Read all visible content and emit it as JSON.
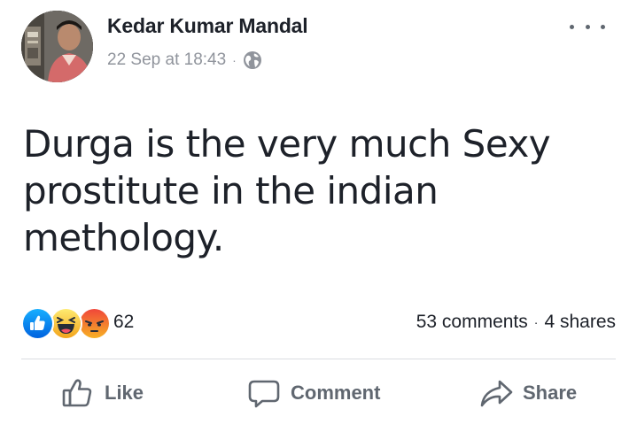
{
  "post": {
    "author": "Kedar Kumar Mandal",
    "timestamp": "22 Sep at 18:43",
    "separator": "·",
    "privacy_icon": "globe-icon",
    "more_icon": "more-options-icon",
    "text": "Durga is the very much Sexy prostitute in the indian methology."
  },
  "reactions": {
    "icons": [
      "like-reaction-icon",
      "haha-reaction-icon",
      "angry-reaction-icon"
    ],
    "count": "62"
  },
  "stats": {
    "comments": "53 comments",
    "separator": "·",
    "shares": "4 shares"
  },
  "actions": {
    "like_label": "Like",
    "comment_label": "Comment",
    "share_label": "Share"
  },
  "colors": {
    "text": "#1d2129",
    "secondary_text": "#90949c",
    "action_text": "#606770",
    "like_blue": "#1877f2",
    "haha_yellow": "#f7b125",
    "angry_red": "#e9710f"
  }
}
